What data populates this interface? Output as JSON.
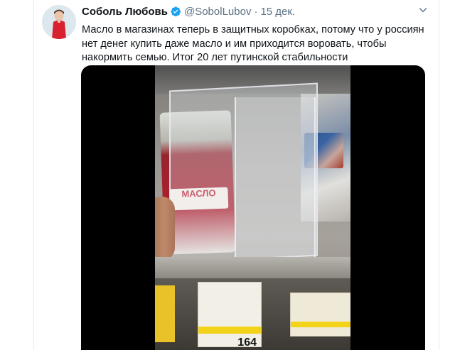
{
  "tweet": {
    "author_name": "Соболь Любовь",
    "handle": "@SobolLubov",
    "separator": "·",
    "date": "15 дек.",
    "text": "Масло в магазинах теперь в защитных коробках, потому что у россиян нет денег купить даже масло и им приходится воровать, чтобы накормить семью. Итог 20 лет путинской стабильности"
  },
  "media": {
    "package_label": "МАСЛО",
    "price": "164"
  },
  "colors": {
    "verified": "#1da1f2",
    "secondary_text": "#5b7083",
    "avatar_dress": "#d8202f"
  },
  "icons": {
    "verified": "verified-badge-icon",
    "menu": "chevron-down-icon"
  }
}
